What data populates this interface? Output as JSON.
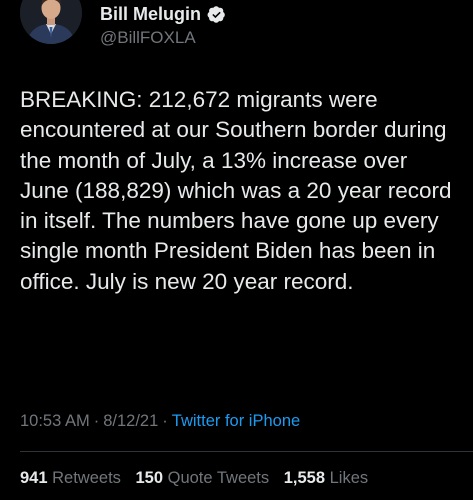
{
  "author": {
    "display_name": "Bill Melugin",
    "handle": "@BillFOXLA",
    "verified": true,
    "avatar_icon": "profile-photo"
  },
  "tweet": {
    "text": "BREAKING: 212,672 migrants were encountered at our Southern border during the month of July, a 13% increase over June (188,829) which was a 20 year record in itself. The numbers have gone up every single month President Biden has been in office. July is new 20 year record.",
    "time": "10:53 AM",
    "date": "8/12/21",
    "source": "Twitter for iPhone"
  },
  "stats": {
    "retweets_count": "941",
    "retweets_label": "Retweets",
    "quotes_count": "150",
    "quotes_label": "Quote Tweets",
    "likes_count": "1,558",
    "likes_label": "Likes"
  },
  "colors": {
    "background": "#000000",
    "text": "#e7e9ea",
    "muted": "#71767b",
    "link": "#1d9bf0",
    "verified": "#e7e9ea"
  }
}
